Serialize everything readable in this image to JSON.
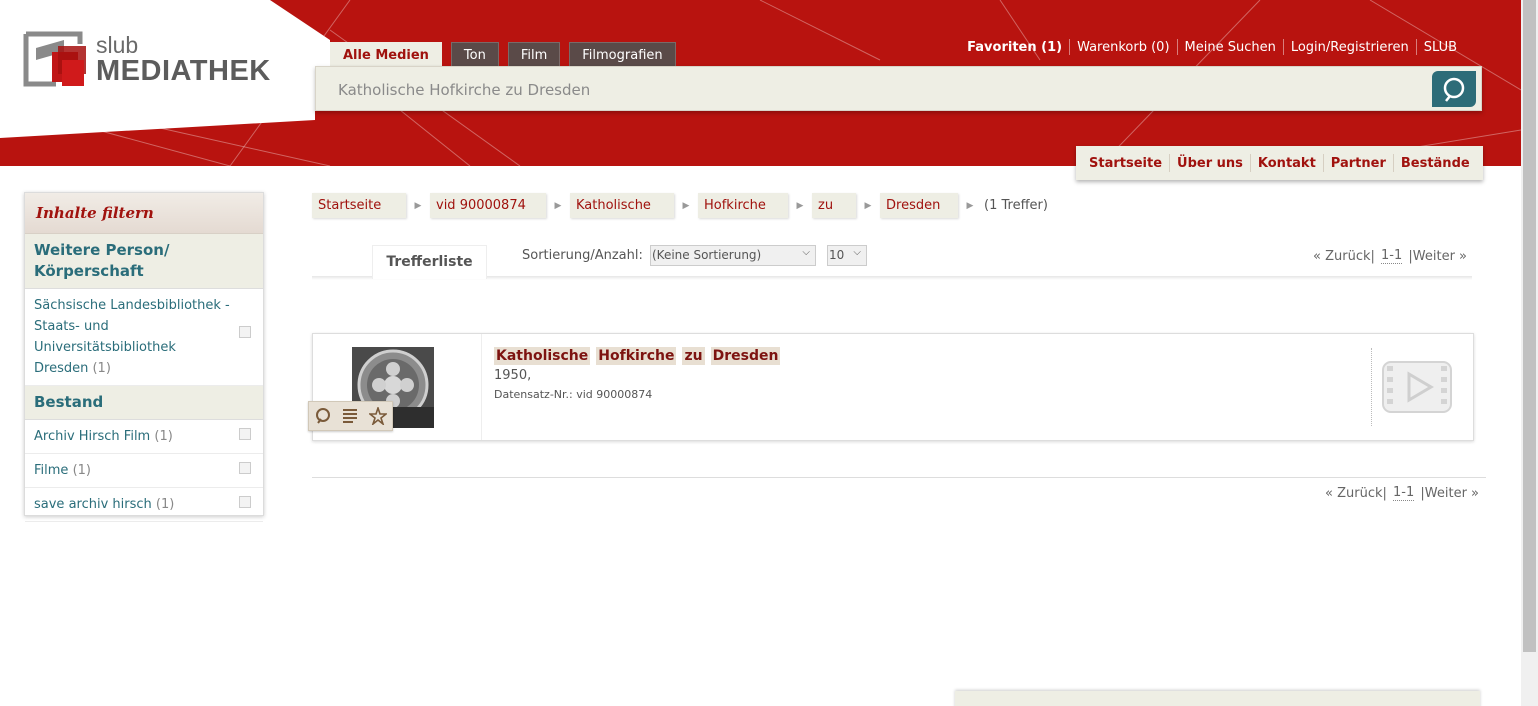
{
  "logo": {
    "line1": "slub",
    "line2": "MEDIATHEK"
  },
  "tabs": [
    {
      "label": "Alle Medien",
      "active": true
    },
    {
      "label": "Ton"
    },
    {
      "label": "Film"
    },
    {
      "label": "Filmografien"
    }
  ],
  "search": {
    "value": "Katholische Hofkirche zu Dresden",
    "placeholder": ""
  },
  "topnav": {
    "favorites": "Favoriten (1)",
    "cart": "Warenkorb (0)",
    "searches": "Meine Suchen",
    "login": "Login/Registrieren",
    "slub": "SLUB"
  },
  "subnav": [
    "Startseite",
    "Über uns",
    "Kontakt",
    "Partner",
    "Bestände"
  ],
  "sidebar": {
    "title": "Inhalte filtern",
    "sections": [
      {
        "title": "Weitere Person/ Körperschaft",
        "items": [
          {
            "label": "Sächsische Landesbibliothek - Staats- und Universitätsbibliothek Dresden",
            "count": "(1)"
          }
        ]
      },
      {
        "title": "Bestand",
        "items": [
          {
            "label": "Archiv Hirsch Film",
            "count": "(1)"
          },
          {
            "label": "Filme",
            "count": "(1)"
          },
          {
            "label": "save archiv hirsch",
            "count": "(1)"
          }
        ]
      }
    ]
  },
  "breadcrumbs": [
    "Startseite",
    "vid 90000874",
    "Katholische",
    "Hofkirche",
    "zu",
    "Dresden"
  ],
  "hit_count": "(1 Treffer)",
  "results_tab": "Trefferliste",
  "sort": {
    "label": "Sortierung/Anzahl:",
    "value": "(Keine Sortierung)",
    "count": "10"
  },
  "pager": {
    "prev": "« Zurück",
    "current": "1-1",
    "next": "Weiter »"
  },
  "result": {
    "title_words": [
      "Katholische",
      "Hofkirche",
      "zu",
      "Dresden"
    ],
    "year": "1950,",
    "record_id": "Datensatz-Nr.: vid 90000874"
  },
  "colors": {
    "brand_red": "#b8130f",
    "accent_teal": "#2a6d7a",
    "panel_beige": "#eeeee4"
  }
}
